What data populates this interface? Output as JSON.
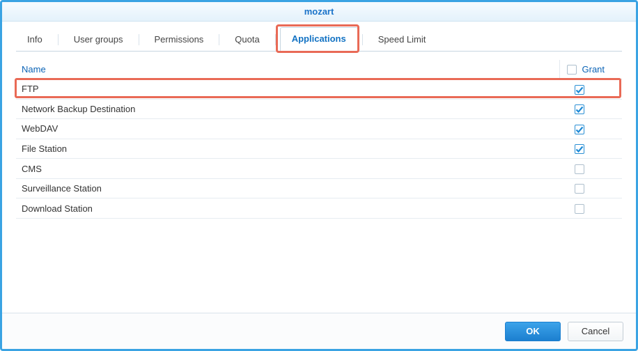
{
  "window": {
    "title": "mozart"
  },
  "tabs": [
    {
      "label": "Info",
      "active": false
    },
    {
      "label": "User groups",
      "active": false
    },
    {
      "label": "Permissions",
      "active": false
    },
    {
      "label": "Quota",
      "active": false
    },
    {
      "label": "Applications",
      "active": true
    },
    {
      "label": "Speed Limit",
      "active": false
    }
  ],
  "table": {
    "name_header": "Name",
    "grant_header": "Grant",
    "header_grant_all_checked": false,
    "rows": [
      {
        "name": "FTP",
        "granted": true,
        "highlighted": true
      },
      {
        "name": "Network Backup Destination",
        "granted": true,
        "highlighted": false
      },
      {
        "name": "WebDAV",
        "granted": true,
        "highlighted": false
      },
      {
        "name": "File Station",
        "granted": true,
        "highlighted": false
      },
      {
        "name": "CMS",
        "granted": false,
        "highlighted": false
      },
      {
        "name": "Surveillance Station",
        "granted": false,
        "highlighted": false
      },
      {
        "name": "Download Station",
        "granted": false,
        "highlighted": false
      }
    ]
  },
  "footer": {
    "ok_label": "OK",
    "cancel_label": "Cancel"
  },
  "annotations": {
    "tab_highlight_index": 4
  }
}
